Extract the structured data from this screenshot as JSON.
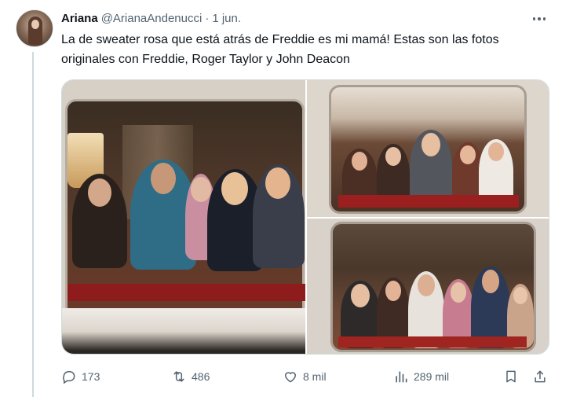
{
  "tweet": {
    "author_name": "Ariana",
    "author_handle": "@ArianaAndenucci",
    "separator": "·",
    "date": "1 jun.",
    "text": "La de sweater rosa que está atrás de Freddie es mi mamá! Estas son las fotos originales con Freddie, Roger Taylor y John Deacon"
  },
  "media": {
    "count": 3
  },
  "actions": {
    "replies": "173",
    "reposts": "486",
    "likes": "8 mil",
    "views": "289 mil"
  },
  "colors": {
    "text": "#0f1419",
    "secondary": "#536471",
    "border": "#cfd9de"
  },
  "icons": [
    "avatar",
    "more-icon",
    "reply-icon",
    "repost-icon",
    "like-icon",
    "views-icon",
    "bookmark-icon",
    "share-icon"
  ]
}
